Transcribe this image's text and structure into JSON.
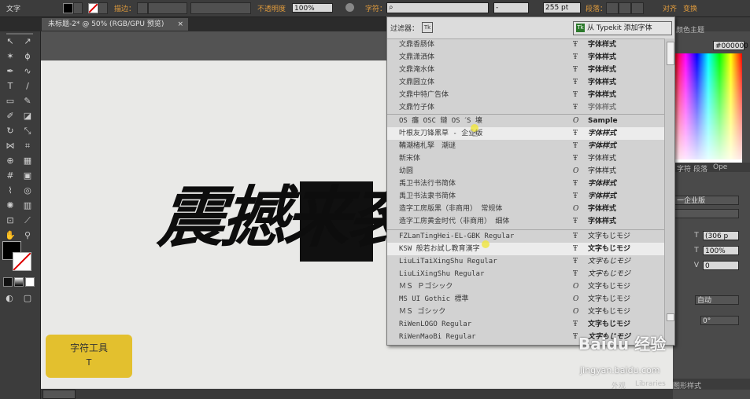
{
  "app": {
    "title": "文字"
  },
  "control_bar": {
    "stroke_label": "描边：",
    "opacity_label": "不透明度",
    "opacity_value": "100%",
    "char_label": "字符：",
    "font_search_value": "",
    "font_style_value": "-",
    "font_size_value": "255 pt",
    "para_label": "段落：",
    "align_label": "对齐",
    "transform_label": "变换"
  },
  "document": {
    "tab_title": "未标题-2* @ 50% (RGB/GPU 预览)"
  },
  "artboard": {
    "text": "震撼来袭"
  },
  "font_menu": {
    "filter_label": "过滤器：",
    "filter_icon": "Tk",
    "typekit_icon": "Tk",
    "typekit_button": "从 Typekit 添加字体",
    "fonts": [
      {
        "name": "文鼎香肠体",
        "icon": "Ŧ",
        "sample": "字体样式"
      },
      {
        "name": "文鼎潇洒体",
        "icon": "Ŧ",
        "sample": "字体样式"
      },
      {
        "name": "文鼎淹水体",
        "icon": "Ŧ",
        "sample": "字体样式"
      },
      {
        "name": "文鼎圆立体",
        "icon": "Ŧ",
        "sample": "字体样式"
      },
      {
        "name": "文鼎中特广告体",
        "icon": "Ŧ",
        "sample": "字体样式"
      },
      {
        "name": "文鼎竹子体",
        "icon": "Ŧ",
        "sample": "字体样式"
      },
      {
        "name": "OS 癱 OSC 鏈 OS ˊS 壊",
        "icon": "O",
        "sample": "Sample"
      },
      {
        "name": "叶根友刀锋黑草 - 企业版",
        "icon": "Ŧ",
        "sample": "字体样式"
      },
      {
        "name": "鞴潮楮札孯　潮谜",
        "icon": "Ŧ",
        "sample": "字体样式"
      },
      {
        "name": "新宋体",
        "icon": "Ŧ",
        "sample": "字体样式"
      },
      {
        "name": "幼圆",
        "icon": "O",
        "sample": "字体样式"
      },
      {
        "name": "禹卫书法行书简体",
        "icon": "Ŧ",
        "sample": "字体样式"
      },
      {
        "name": "禹卫书法隶书简体",
        "icon": "Ŧ",
        "sample": "字体样式"
      },
      {
        "name": "造字工房版黑（非商用） 常规体",
        "icon": "O",
        "sample": "字体样式"
      },
      {
        "name": "造字工房黄金时代（非商用） 细体",
        "icon": "Ŧ",
        "sample": "字体样式"
      },
      {
        "name": "FZLanTingHei-EL-GBK Regular",
        "icon": "Ŧ",
        "sample": "文字もじモジ"
      },
      {
        "name": "KSW 般若お試し教育漢字",
        "icon": "Ŧ",
        "sample": "文字もじモジ"
      },
      {
        "name": "LiuLiTaiXingShu Regular",
        "icon": "Ŧ",
        "sample": "文字もじモジ"
      },
      {
        "name": "LiuLiXingShu Regular",
        "icon": "Ŧ",
        "sample": "文字もじモジ"
      },
      {
        "name": "ＭＳ Ｐゴシック",
        "icon": "O",
        "sample": "文字もじモジ"
      },
      {
        "name": "MS UI Gothic 標準",
        "icon": "O",
        "sample": "文字もじモジ"
      },
      {
        "name": "ＭＳ ゴシック",
        "icon": "O",
        "sample": "文字もじモジ"
      },
      {
        "name": "RiWenLOGO Regular",
        "icon": "Ŧ",
        "sample": "文字もじモジ"
      },
      {
        "name": "RiWenMaoBi Regular",
        "icon": "Ŧ",
        "sample": "文字もじモジ"
      }
    ]
  },
  "right_panel": {
    "color_tab": "颜色主题",
    "hex_value": "000000",
    "char_tabs": [
      "字符",
      "段落",
      "Ope"
    ],
    "font_name": "一企业版",
    "size_value": "(306 p",
    "scale_value": "100%",
    "tracking_value": "0",
    "auto_value": "自动",
    "rotate_value": "0°",
    "bottom_tabs": [
      "外观",
      "Libraries",
      "图形样式"
    ]
  },
  "tool_card": {
    "title": "字符工具",
    "shortcut": "T"
  },
  "watermark": {
    "brand": "Baidu 经验",
    "url": "jingyan.baidu.com"
  }
}
